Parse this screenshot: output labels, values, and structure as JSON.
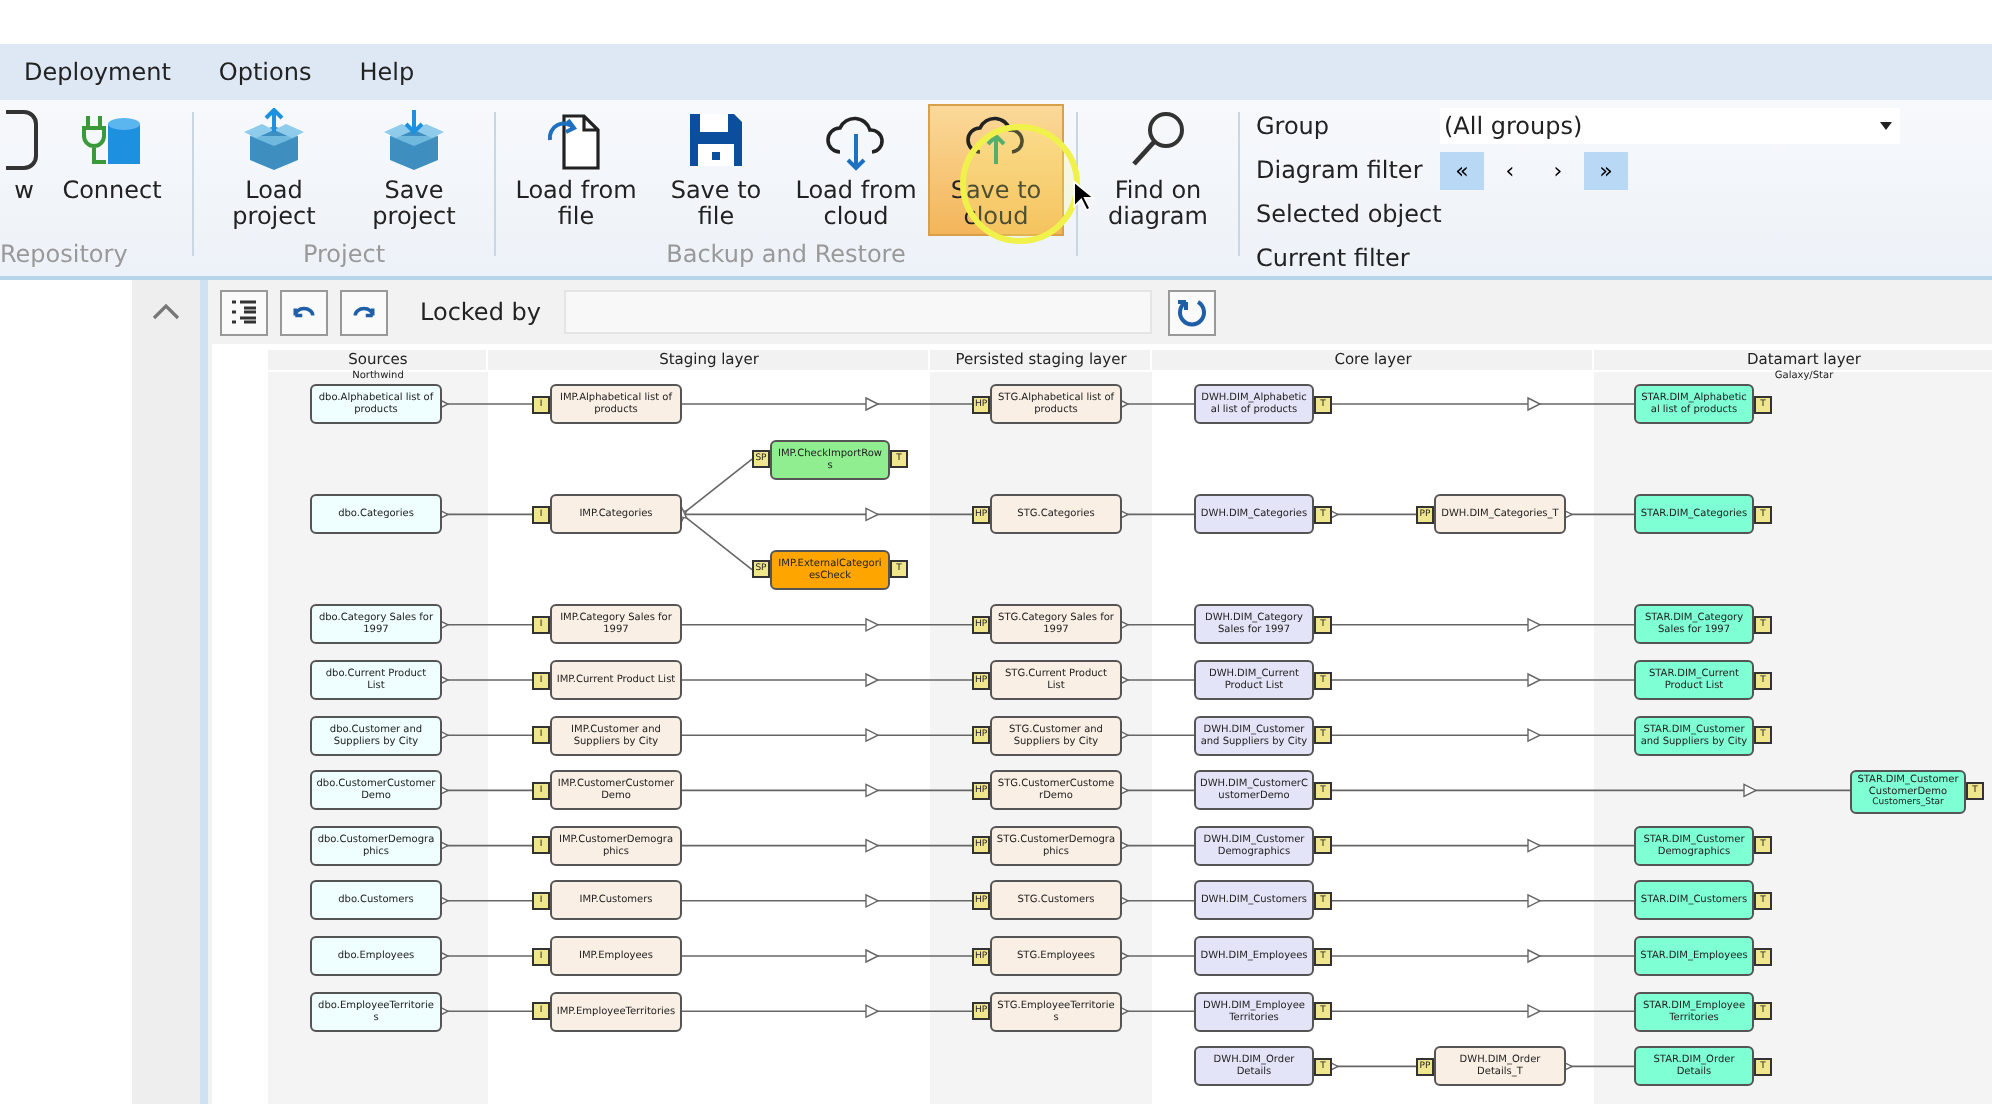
{
  "menu": [
    {
      "label": "Deployment"
    },
    {
      "label": "Options"
    },
    {
      "label": "Help"
    }
  ],
  "ribbon": {
    "groups": [
      {
        "label": "Repository",
        "buttons": [
          {
            "label": "w",
            "selected": false
          },
          {
            "label": "Connect",
            "selected": false
          }
        ]
      },
      {
        "label": "Project",
        "buttons": [
          {
            "label": "Load project",
            "selected": false
          },
          {
            "label": "Save project",
            "selected": false
          }
        ]
      },
      {
        "label": "Backup and Restore",
        "buttons": [
          {
            "label": "Load from file",
            "selected": false
          },
          {
            "label": "Save to file",
            "selected": false
          },
          {
            "label": "Load from cloud",
            "selected": false
          },
          {
            "label": "Save to cloud",
            "selected": true
          }
        ]
      },
      {
        "buttons": [
          {
            "label": "Find on diagram",
            "selected": false
          }
        ]
      }
    ],
    "filters": {
      "group_label": "Group",
      "group_value": "(All groups)",
      "filter_label": "Diagram filter",
      "nav": [
        {
          "label": "«",
          "selected": true
        },
        {
          "label": "‹",
          "selected": false
        },
        {
          "label": "›",
          "selected": false
        },
        {
          "label": "»",
          "selected": true
        }
      ],
      "selected_object_label": "Selected object",
      "current_filter_label": "Current filter"
    }
  },
  "toolbar": {
    "locked_by_label": "Locked by"
  },
  "diagram": {
    "layers": [
      {
        "title": "Sources",
        "subtitle": "Northwind"
      },
      {
        "title": "Staging layer"
      },
      {
        "title": "Persisted staging layer"
      },
      {
        "title": "Core layer"
      },
      {
        "title": "Datamart layer",
        "subtitle": "Galaxy/Star"
      }
    ],
    "rows": [
      {
        "cells": [
          {
            "kind": "source",
            "label": "dbo.Alphabetical list of products",
            "color": "#effefe"
          },
          {
            "kind": "import",
            "label": "IMP.Alphabetical list of products",
            "color": "#faefe4",
            "in_badge": "I"
          },
          null,
          {
            "kind": "persist",
            "label": "STG.Alphabetical list of products",
            "color": "#faefe4",
            "in_badge": "HP"
          },
          {
            "kind": "core",
            "label": "DWH.DIM_Alphabetical list of products",
            "color": "#e4e4f8",
            "out_badge": "T"
          },
          null,
          {
            "kind": "star",
            "label": "STAR.DIM_Alphabetical list of products",
            "color": "#7fffd4",
            "out_badge": "T"
          },
          null
        ]
      },
      {
        "cells": [
          null,
          null,
          {
            "kind": "check",
            "label": "IMP.CheckImportRows",
            "color": "#90ee90",
            "in_badge": "SP",
            "out_badge": "T"
          },
          null,
          null,
          null,
          null,
          null
        ]
      },
      {
        "cells": [
          {
            "kind": "source",
            "label": "dbo.Categories",
            "color": "#effefe"
          },
          {
            "kind": "import",
            "label": "IMP.Categories",
            "color": "#faefe4",
            "in_badge": "I"
          },
          null,
          {
            "kind": "persist",
            "label": "STG.Categories",
            "color": "#faefe4",
            "in_badge": "HP"
          },
          {
            "kind": "core",
            "label": "DWH.DIM_Categories",
            "color": "#e4e4f8",
            "out_badge": "T"
          },
          {
            "kind": "transform",
            "label": "DWH.DIM_Categories_T",
            "color": "#faefe4",
            "in_badge": "PP"
          },
          {
            "kind": "star",
            "label": "STAR.DIM_Categories",
            "color": "#7fffd4",
            "out_badge": "T"
          },
          null
        ]
      },
      {
        "cells": [
          null,
          null,
          {
            "kind": "check",
            "label": "IMP.ExternalCategoriesCheck",
            "color": "#ffa500",
            "in_badge": "SP",
            "out_badge": "T"
          },
          null,
          null,
          null,
          null,
          null
        ]
      },
      {
        "cells": [
          {
            "kind": "source",
            "label": "dbo.Category Sales for 1997",
            "color": "#effefe"
          },
          {
            "kind": "import",
            "label": "IMP.Category Sales for 1997",
            "color": "#faefe4",
            "in_badge": "I"
          },
          null,
          {
            "kind": "persist",
            "label": "STG.Category Sales for 1997",
            "color": "#faefe4",
            "in_badge": "HP"
          },
          {
            "kind": "core",
            "label": "DWH.DIM_Category Sales for 1997",
            "color": "#e4e4f8",
            "out_badge": "T"
          },
          null,
          {
            "kind": "star",
            "label": "STAR.DIM_Category Sales for 1997",
            "color": "#7fffd4",
            "out_badge": "T"
          },
          null
        ]
      },
      {
        "cells": [
          {
            "kind": "source",
            "label": "dbo.Current Product List",
            "color": "#effefe"
          },
          {
            "kind": "import",
            "label": "IMP.Current Product List",
            "color": "#faefe4",
            "in_badge": "I"
          },
          null,
          {
            "kind": "persist",
            "label": "STG.Current Product List",
            "color": "#faefe4",
            "in_badge": "HP"
          },
          {
            "kind": "core",
            "label": "DWH.DIM_Current Product List",
            "color": "#e4e4f8",
            "out_badge": "T"
          },
          null,
          {
            "kind": "star",
            "label": "STAR.DIM_Current Product List",
            "color": "#7fffd4",
            "out_badge": "T"
          },
          null
        ]
      },
      {
        "cells": [
          {
            "kind": "source",
            "label": "dbo.Customer and Suppliers by City",
            "color": "#effefe"
          },
          {
            "kind": "import",
            "label": "IMP.Customer and Suppliers by City",
            "color": "#faefe4",
            "in_badge": "I"
          },
          null,
          {
            "kind": "persist",
            "label": "STG.Customer and Suppliers by City",
            "color": "#faefe4",
            "in_badge": "HP"
          },
          {
            "kind": "core",
            "label": "DWH.DIM_Customer and Suppliers by City",
            "color": "#e4e4f8",
            "out_badge": "T"
          },
          null,
          {
            "kind": "star",
            "label": "STAR.DIM_Customer and Suppliers by City",
            "color": "#7fffd4",
            "out_badge": "T"
          },
          null
        ]
      },
      {
        "cells": [
          {
            "kind": "source",
            "label": "dbo.CustomerCustomerDemo",
            "color": "#effefe"
          },
          {
            "kind": "import",
            "label": "IMP.CustomerCustomerDemo",
            "color": "#faefe4",
            "in_badge": "I"
          },
          null,
          {
            "kind": "persist",
            "label": "STG.CustomerCustomerDemo",
            "color": "#faefe4",
            "in_badge": "HP"
          },
          {
            "kind": "core",
            "label": "DWH.DIM_CustomerCustomerDemo",
            "color": "#e4e4f8",
            "out_badge": "T"
          },
          null,
          null,
          {
            "kind": "star",
            "label": "STAR.DIM_CustomerCustomerDemo",
            "subtitle": "Customers_Star",
            "color": "#7fffd4",
            "out_badge": "T"
          }
        ]
      },
      {
        "cells": [
          {
            "kind": "source",
            "label": "dbo.CustomerDemographics",
            "color": "#effefe"
          },
          {
            "kind": "import",
            "label": "IMP.CustomerDemographics",
            "color": "#faefe4",
            "in_badge": "I"
          },
          null,
          {
            "kind": "persist",
            "label": "STG.CustomerDemographics",
            "color": "#faefe4",
            "in_badge": "HP"
          },
          {
            "kind": "core",
            "label": "DWH.DIM_CustomerDemographics",
            "color": "#e4e4f8",
            "out_badge": "T"
          },
          null,
          {
            "kind": "star",
            "label": "STAR.DIM_CustomerDemographics",
            "color": "#7fffd4",
            "out_badge": "T"
          },
          null
        ]
      },
      {
        "cells": [
          {
            "kind": "source",
            "label": "dbo.Customers",
            "color": "#effefe"
          },
          {
            "kind": "import",
            "label": "IMP.Customers",
            "color": "#faefe4",
            "in_badge": "I"
          },
          null,
          {
            "kind": "persist",
            "label": "STG.Customers",
            "color": "#faefe4",
            "in_badge": "HP"
          },
          {
            "kind": "core",
            "label": "DWH.DIM_Customers",
            "color": "#e4e4f8",
            "out_badge": "T"
          },
          null,
          {
            "kind": "star",
            "label": "STAR.DIM_Customers",
            "color": "#7fffd4",
            "out_badge": "T"
          },
          null
        ]
      },
      {
        "cells": [
          {
            "kind": "source",
            "label": "dbo.Employees",
            "color": "#effefe"
          },
          {
            "kind": "import",
            "label": "IMP.Employees",
            "color": "#faefe4",
            "in_badge": "I"
          },
          null,
          {
            "kind": "persist",
            "label": "STG.Employees",
            "color": "#faefe4",
            "in_badge": "HP"
          },
          {
            "kind": "core",
            "label": "DWH.DIM_Employees",
            "color": "#e4e4f8",
            "out_badge": "T"
          },
          null,
          {
            "kind": "star",
            "label": "STAR.DIM_Employees",
            "color": "#7fffd4",
            "out_badge": "T"
          },
          null
        ]
      },
      {
        "cells": [
          {
            "kind": "source",
            "label": "dbo.EmployeeTerritories",
            "color": "#effefe"
          },
          {
            "kind": "import",
            "label": "IMP.EmployeeTerritories",
            "color": "#faefe4",
            "in_badge": "I"
          },
          null,
          {
            "kind": "persist",
            "label": "STG.EmployeeTerritories",
            "color": "#faefe4",
            "in_badge": "HP"
          },
          {
            "kind": "core",
            "label": "DWH.DIM_EmployeeTerritories",
            "color": "#e4e4f8",
            "out_badge": "T"
          },
          null,
          {
            "kind": "star",
            "label": "STAR.DIM_EmployeeTerritories",
            "color": "#7fffd4",
            "out_badge": "T"
          },
          null
        ]
      },
      {
        "cells": [
          null,
          null,
          null,
          null,
          {
            "kind": "core",
            "label": "DWH.DIM_Order Details",
            "color": "#e4e4f8",
            "out_badge": "T"
          },
          {
            "kind": "transform",
            "label": "DWH.DIM_Order Details_T",
            "color": "#faefe4",
            "in_badge": "PP"
          },
          {
            "kind": "star",
            "label": "STAR.DIM_Order Details",
            "color": "#7fffd4",
            "out_badge": "T"
          },
          null
        ]
      }
    ]
  }
}
